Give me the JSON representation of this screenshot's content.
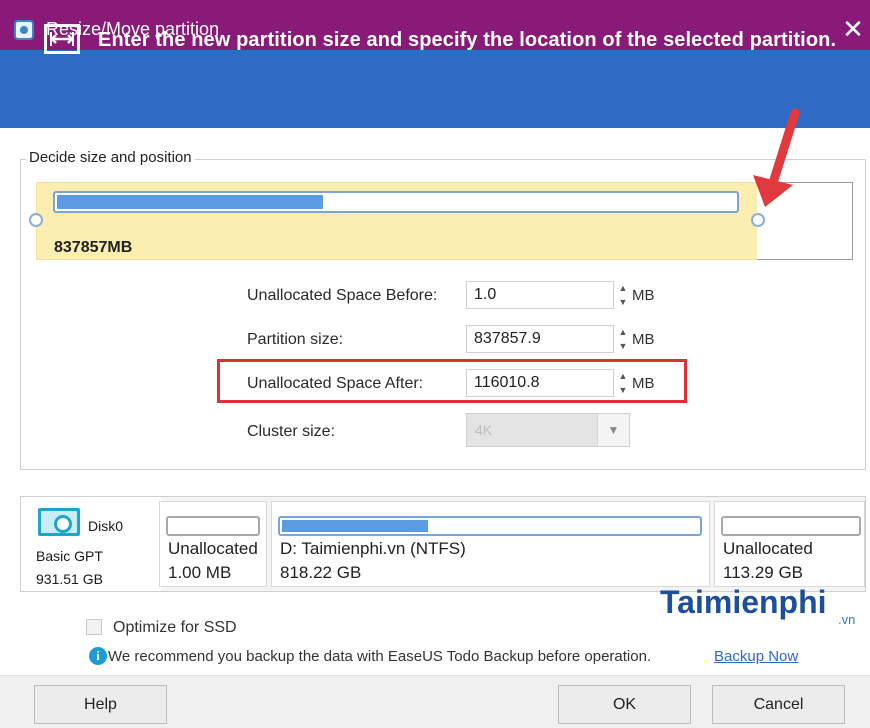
{
  "window": {
    "title": "Resize/Move partition",
    "close_glyph": "✕"
  },
  "banner": {
    "icon": "resize-arrows-icon",
    "text": "Enter the new partition size and specify the location of the selected partition."
  },
  "size_position": {
    "legend": "Decide size and position",
    "partition_size_label": "837857MB",
    "used_fraction": 0.39,
    "partition_fraction": 0.88
  },
  "fields": {
    "unalloc_before": {
      "label": "Unallocated Space Before:",
      "value": "1.0",
      "unit": "MB"
    },
    "partition_size": {
      "label": "Partition size:",
      "value": "837857.9",
      "unit": "MB"
    },
    "unalloc_after": {
      "label": "Unallocated Space After:",
      "value": "116010.8",
      "unit": "MB"
    },
    "cluster_size": {
      "label": "Cluster size:",
      "value": "4K"
    }
  },
  "disk": {
    "name": "Disk0",
    "type": "Basic GPT",
    "capacity": "931.51 GB",
    "segments": [
      {
        "name": "Unallocated",
        "size": "1.00 MB",
        "fill": 0
      },
      {
        "name": "D: Taimienphi.vn (NTFS)",
        "size": "818.22 GB",
        "fill": 0.35
      },
      {
        "name": "Unallocated",
        "size": "113.29 GB",
        "fill": 0
      }
    ]
  },
  "options": {
    "optimize_ssd": "Optimize for SSD",
    "info_text": "We recommend you backup the data with EaseUS Todo Backup before operation.",
    "backup_link": "Backup Now"
  },
  "buttons": {
    "help": "Help",
    "ok": "OK",
    "cancel": "Cancel"
  },
  "watermark": {
    "text": "Taimienphi",
    "suffix": ".vn"
  },
  "colors": {
    "titlebar": "#8a1a78",
    "banner": "#2f6bc4",
    "partition_area": "#fbeeb0",
    "bar_fill": "#5b9be1",
    "highlight": "#d9343a",
    "arrow": "#e0393e"
  }
}
